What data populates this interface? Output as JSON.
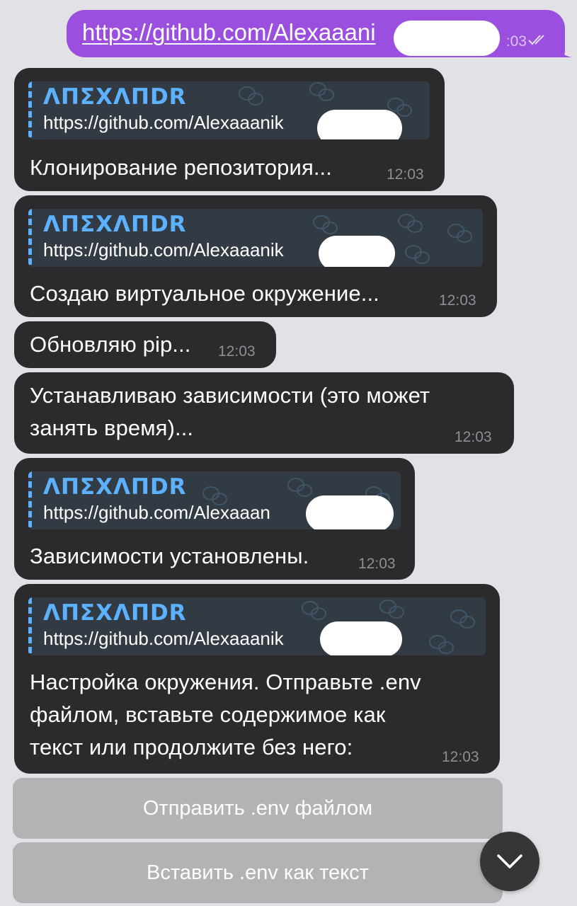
{
  "outgoing": {
    "link": "https://github.com/Alexaaani",
    "time": ":03"
  },
  "messages": [
    {
      "quote_name": "ΛΠΣXΛΠDR",
      "quote_link": "https://github.com/Alexaaanik",
      "lines": [
        "Клонирование репозитория..."
      ],
      "time": "12:03"
    },
    {
      "quote_name": "ΛΠΣXΛΠDR",
      "quote_link": "https://github.com/Alexaaanik",
      "lines": [
        "Создаю виртуальное окружение..."
      ],
      "time": "12:03"
    },
    {
      "lines": [
        "Обновляю pip..."
      ],
      "time": "12:03"
    },
    {
      "lines": [
        "Устанавливаю зависимости (это может",
        "занять время)..."
      ],
      "time": "12:03"
    },
    {
      "quote_name": "ΛΠΣXΛΠDR",
      "quote_link": "https://github.com/Alexaaan",
      "lines": [
        "Зависимости установлены."
      ],
      "time": "12:03"
    },
    {
      "quote_name": "ΛΠΣXΛΠDR",
      "quote_link": "https://github.com/Alexaaanik",
      "lines": [
        "Настройка окружения. Отправьте .env",
        "файлом, вставьте содержимое как",
        "текст или продолжите без него:"
      ],
      "time": "12:03"
    }
  ],
  "keyboard": {
    "send_file_label": "Отправить .env файлом",
    "paste_text_label": "Вставить .env как текст"
  },
  "icons": {
    "read_receipt": "double-check-icon",
    "scroll_down": "chevron-down-icon"
  },
  "colors": {
    "outgoing_bubble": "#9b4fde",
    "incoming_bubble": "#2b2b2d",
    "quote_name": "#5cb2ff",
    "chat_background": "#e2e1e6"
  }
}
